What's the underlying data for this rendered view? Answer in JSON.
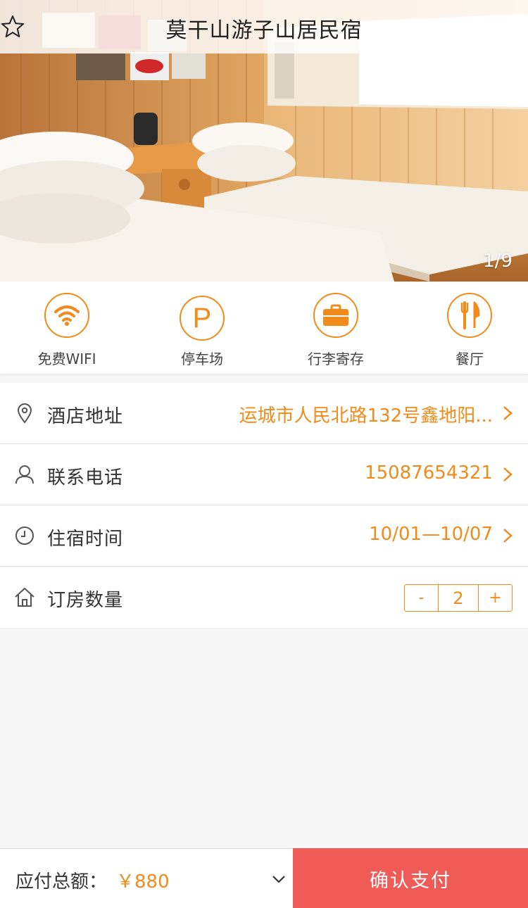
{
  "header": {
    "title": "莫干山游子山居民宿",
    "favorite_icon": "star-outline-icon"
  },
  "gallery": {
    "counter": "1/9"
  },
  "amenities": [
    {
      "label": "免费WIFI",
      "icon": "wifi-icon"
    },
    {
      "label": "停车场",
      "icon": "parking-icon"
    },
    {
      "label": "行李寄存",
      "icon": "luggage-icon"
    },
    {
      "label": "餐厅",
      "icon": "restaurant-icon"
    }
  ],
  "info": {
    "address": {
      "label": "酒店地址",
      "value": "运城市人民北路132号鑫地阳...",
      "icon": "location-pin-icon"
    },
    "phone": {
      "label": "联系电话",
      "value": "15087654321",
      "icon": "person-icon"
    },
    "dates": {
      "label": "住宿时间",
      "value": "10/01—10/07",
      "icon": "clock-icon"
    },
    "rooms": {
      "label": "订房数量",
      "icon": "house-icon",
      "decrement": "-",
      "quantity": "2",
      "increment": "+"
    }
  },
  "footer": {
    "total_label": "应付总额：",
    "total_amount": "￥880",
    "pay_label": "确认支付"
  },
  "colors": {
    "accent": "#f08b1c",
    "pay_button": "#ef5b56",
    "background": "#f7f7f7"
  }
}
